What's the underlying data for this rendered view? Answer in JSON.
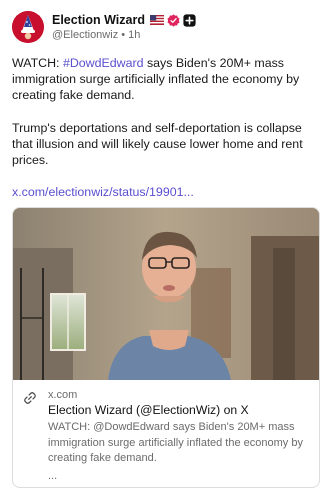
{
  "author": {
    "display_name": "Election Wizard",
    "handle_line": "@Electionwiz • 1h",
    "icons": [
      "wizard-avatar",
      "us-flag-icon",
      "verified-badge-icon",
      "plus-badge-icon"
    ]
  },
  "post": {
    "p1_prefix": "WATCH: ",
    "p1_hashtag": "#DowdEdward",
    "p1_rest": " says Biden's 20M+ mass immigration surge artificially inflated the economy by creating fake demand.",
    "p2": "Trump's deportations and self-deportation is collapse that illusion and will likely cause lower home and rent prices.",
    "link_text": "x.com/electionwiz/status/19901..."
  },
  "card": {
    "domain": "x.com",
    "title": "Election Wizard (@ElectionWiz) on X",
    "description": "WATCH: @DowdEdward says Biden's 20M+ mass immigration surge artificially inflated the economy by creating fake demand.",
    "ellipsis": "...",
    "icon": "link-icon"
  },
  "colors": {
    "accent": "#5a4fcf",
    "avatar_red": "#c8102e",
    "verified": "#e0245e",
    "muted_text": "#6b6b6b"
  }
}
